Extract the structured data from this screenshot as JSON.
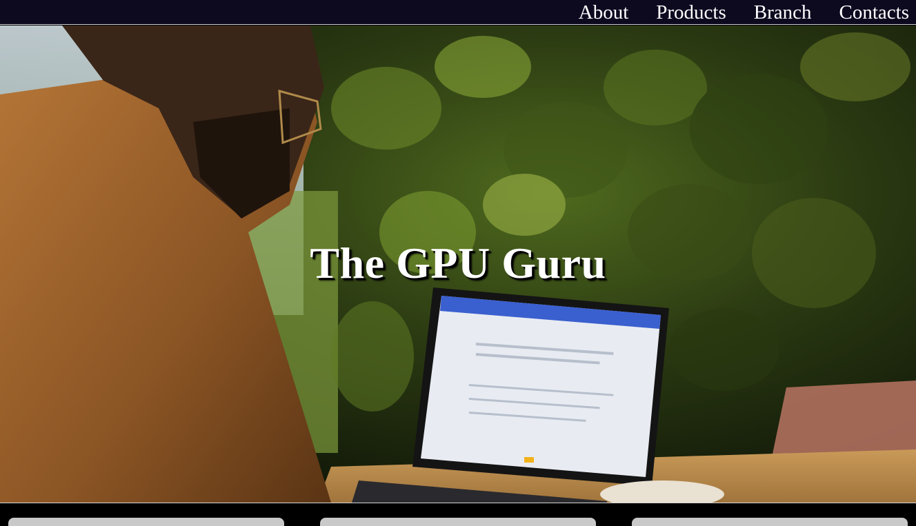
{
  "nav": {
    "items": [
      {
        "label": "About"
      },
      {
        "label": "Products"
      },
      {
        "label": "Branch"
      },
      {
        "label": "Contacts"
      }
    ]
  },
  "hero": {
    "title": "The GPU Guru"
  },
  "colors": {
    "topbar_bg": "#0d0a20",
    "nav_text": "#ffffff",
    "card_bg": "#c9c9c9",
    "page_bg": "#000000"
  }
}
